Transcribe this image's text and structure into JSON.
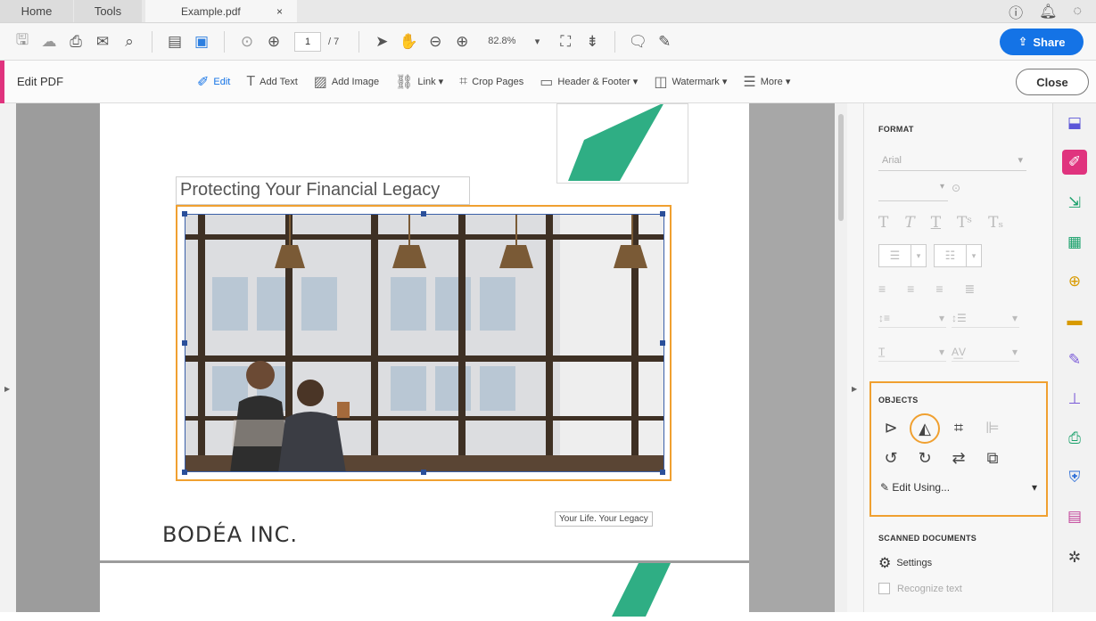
{
  "tabs": {
    "home": "Home",
    "tools": "Tools",
    "document": "Example.pdf",
    "document_close": "×"
  },
  "tabbar_icons": [
    "help-icon",
    "bell-icon",
    "account-icon"
  ],
  "toolbar": {
    "page_current": "1",
    "page_total": "/ 7",
    "zoom": "82.8%",
    "share_label": "Share"
  },
  "editbar": {
    "title": "Edit PDF",
    "tools": [
      {
        "label": "Edit",
        "icon": "edit-icon",
        "active": true
      },
      {
        "label": "Add Text",
        "icon": "text-icon"
      },
      {
        "label": "Add Image",
        "icon": "image-icon"
      },
      {
        "label": "Link ▾",
        "icon": "link-icon"
      },
      {
        "label": "Crop Pages",
        "icon": "crop-icon"
      },
      {
        "label": "Header & Footer ▾",
        "icon": "header-footer-icon"
      },
      {
        "label": "Watermark ▾",
        "icon": "watermark-icon"
      },
      {
        "label": "More ▾",
        "icon": "more-icon"
      }
    ],
    "close_label": "Close"
  },
  "document": {
    "headline": "Protecting Your Financial Legacy",
    "company": "BODÉA INC.",
    "tagline": "Your Life. Your Legacy"
  },
  "panel": {
    "format_title": "FORMAT",
    "font_value": "Arial",
    "objects_title": "OBJECTS",
    "edit_using_label": "Edit Using...",
    "scanned_title": "SCANNED DOCUMENTS",
    "settings_label": "Settings",
    "recognize_label": "Recognize text"
  },
  "colors": {
    "accent_pink": "#e0337e",
    "share_blue": "#1473e6",
    "highlight_orange": "#f0a030",
    "logo_green": "#2fae84"
  }
}
